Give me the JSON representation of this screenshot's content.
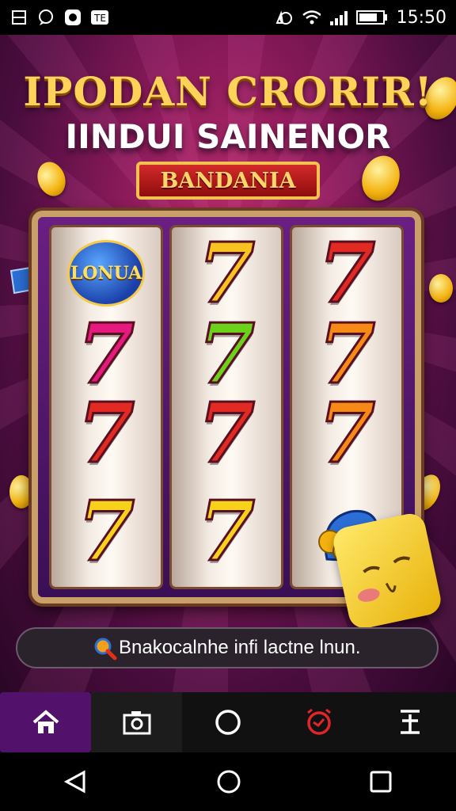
{
  "status_bar": {
    "time": "15:50",
    "left_icons": [
      "notification-icon",
      "chat-icon",
      "record-icon",
      "app-icon"
    ],
    "right_icons": [
      "alarm-icon",
      "wifi-icon",
      "signal-icon",
      "battery-icon"
    ]
  },
  "hero": {
    "title_line1": "IPODAN CRORIR!",
    "title_line2": "IINDUI SAINENOR",
    "banner_label": "BANDANIA",
    "reels": [
      [
        "LONUA",
        "7",
        "7",
        "7"
      ],
      [
        "7",
        "7",
        "7",
        "7"
      ],
      [
        "7",
        "7",
        "7",
        "coins"
      ]
    ],
    "seven_colors": [
      [
        "#f0b8e0",
        "#e6197e",
        "#e12a22",
        "#f6d21a"
      ],
      [
        "#f7c321",
        "#6ad21a",
        "#e12a22",
        "#f6d21a"
      ],
      [
        "#e12a22",
        "#f58a16",
        "#f58a16",
        "#2b6fd6"
      ]
    ]
  },
  "search": {
    "text": "Bnakocalnhe infi lactne lnun."
  },
  "tab_bar": {
    "tabs": [
      "home-icon",
      "camera-icon",
      "circle-icon",
      "clock-icon",
      "upload-icon"
    ],
    "active_index": 0
  },
  "nav_bar": {
    "buttons": [
      "back-icon",
      "home-circle-icon",
      "recents-icon"
    ]
  },
  "colors": {
    "accent": "#52126b",
    "gold": "#ffd25a",
    "red": "#e12a22"
  }
}
